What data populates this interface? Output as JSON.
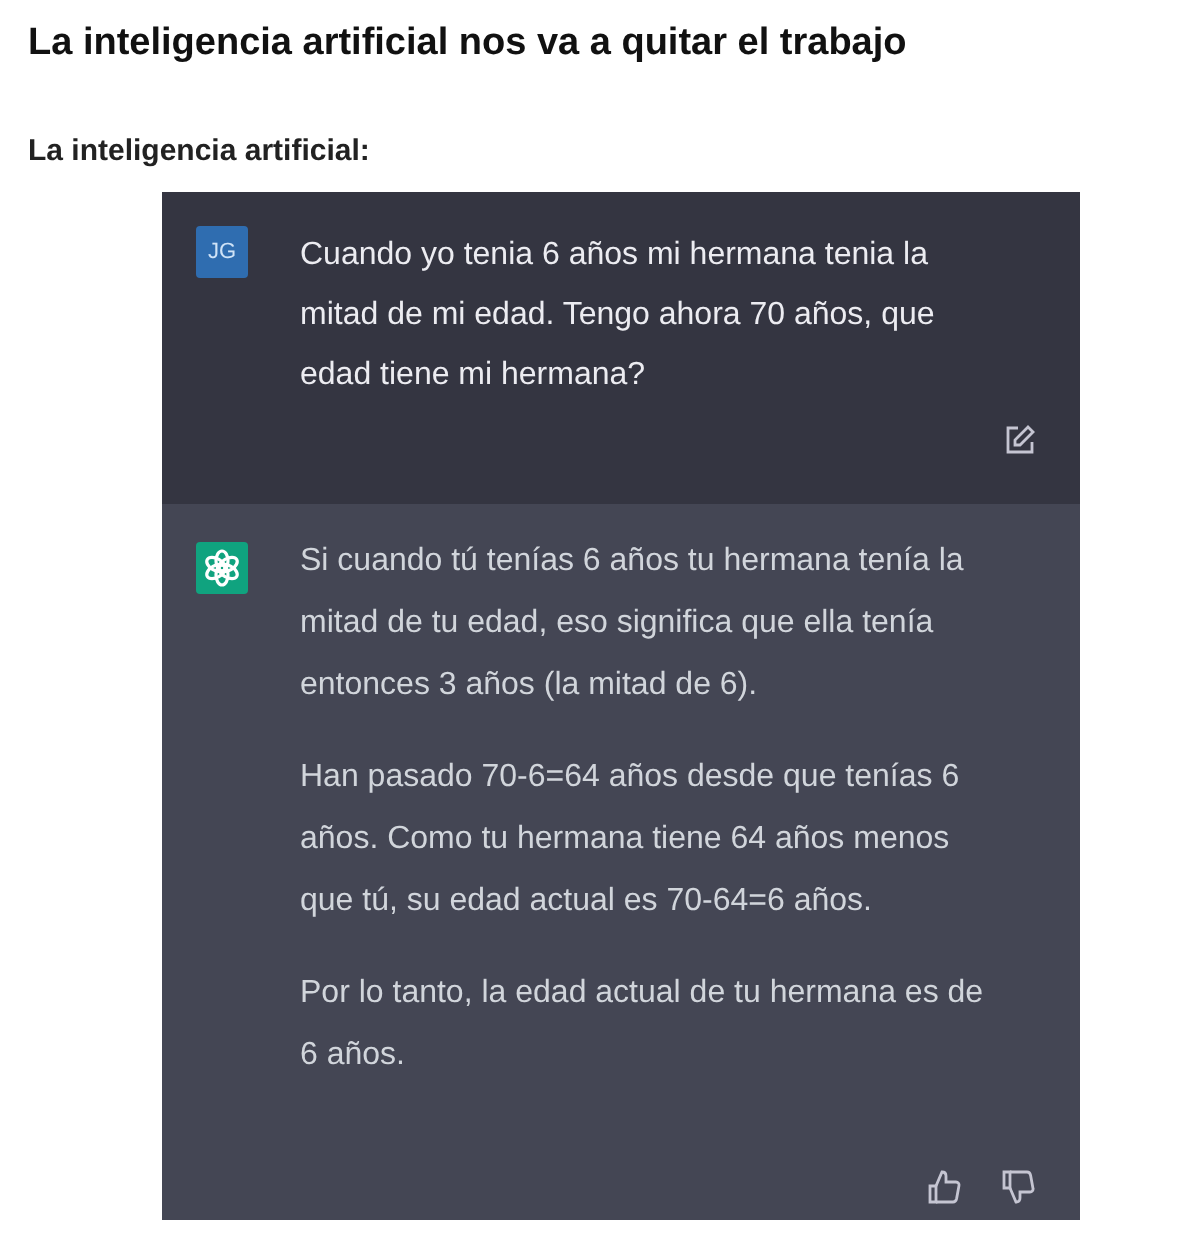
{
  "title": "La inteligencia artificial nos va a quitar el trabajo",
  "subtitle": "La inteligencia artificial:",
  "messages": [
    {
      "kind": "user",
      "avatar": "JG",
      "paragraphs": [
        "Cuando yo tenia 6 años mi hermana tenia la mitad de mi edad. Tengo ahora 70 años, que edad tiene mi hermana?"
      ]
    },
    {
      "kind": "assistant",
      "paragraphs": [
        "Si cuando tú tenías 6 años tu hermana tenía la mitad de tu edad, eso significa que ella tenía entonces 3 años (la mitad de 6).",
        "Han pasado 70-6=64 años desde que tenías 6 años. Como tu hermana tiene 64 años menos que tú, su edad actual es 70-64=6 años.",
        "Por lo tanto, la edad actual de tu hermana es de 6 años."
      ]
    }
  ]
}
